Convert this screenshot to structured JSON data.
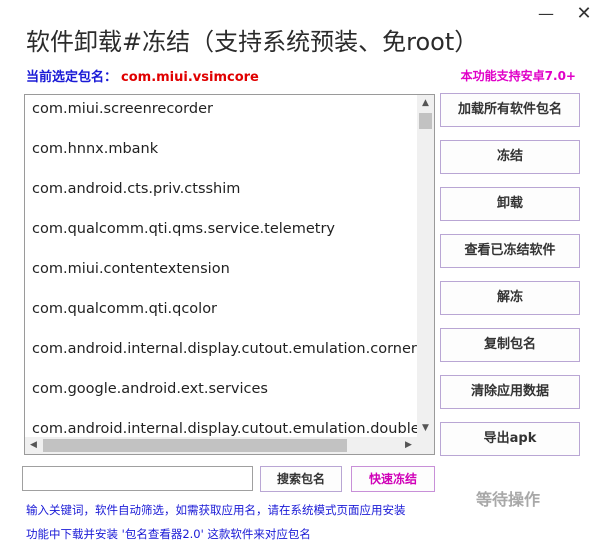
{
  "window": {
    "title": "软件卸载#冻结（支持系统预装、免root）",
    "minimize": "—",
    "close": "✕"
  },
  "selected": {
    "label": "当前选定包名：",
    "value": "com.miui.vsimcore"
  },
  "support_note": "本功能支持安卓7.0+",
  "packages": [
    "com.miui.screenrecorder",
    "com.hnnx.mbank",
    "com.android.cts.priv.ctsshim",
    "com.qualcomm.qti.qms.service.telemetry",
    "com.miui.contentextension",
    "com.qualcomm.qti.qcolor",
    "com.android.internal.display.cutout.emulation.corner",
    "com.google.android.ext.services",
    "com.android.internal.display.cutout.emulation.double"
  ],
  "buttons": {
    "load_all": "加载所有软件包名",
    "freeze": "冻结",
    "uninstall": "卸载",
    "view_frozen": "查看已冻结软件",
    "unfreeze": "解冻",
    "copy_name": "复制包名",
    "clear_data": "清除应用数据",
    "export_apk": "导出apk",
    "search": "搜索包名",
    "quick_freeze": "快速冻结"
  },
  "search": {
    "value": "",
    "placeholder": ""
  },
  "hints": {
    "line1": "输入关键词，软件自动筛选，如需获取应用名，请在系统模式页面应用安装",
    "line2": "功能中下载并安装 '包名查看器2.0' 这款软件来对应包名"
  },
  "status": "等待操作",
  "icons": {
    "scroll_up": "▲",
    "scroll_down": "▼",
    "scroll_left": "◀",
    "scroll_right": "▶"
  },
  "colors": {
    "title_text": "#2b2b2b",
    "label_blue": "#1a1ad6",
    "selected_red": "#e00000",
    "accent_magenta": "#e000c8",
    "button_border": "#b9a6d4",
    "status_gray": "#a8a8a8"
  }
}
